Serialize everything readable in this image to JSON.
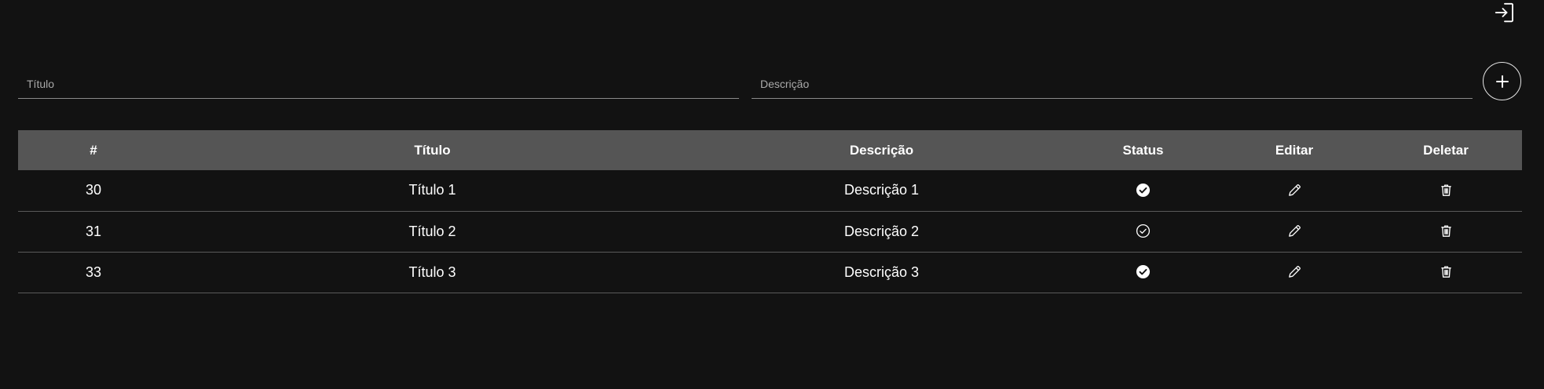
{
  "header": {
    "logout_icon": "sign-in-icon"
  },
  "form": {
    "title_placeholder": "Título",
    "title_value": "",
    "description_placeholder": "Descrição",
    "description_value": "",
    "add_icon": "plus-icon"
  },
  "table": {
    "columns": [
      "#",
      "Título",
      "Descrição",
      "Status",
      "Editar",
      "Deletar"
    ],
    "rows": [
      {
        "id": "30",
        "title": "Título 1",
        "description": "Descrição 1",
        "status": "done"
      },
      {
        "id": "31",
        "title": "Título 2",
        "description": "Descrição 2",
        "status": "pending"
      },
      {
        "id": "33",
        "title": "Título 3",
        "description": "Descrição 3",
        "status": "done"
      }
    ],
    "icons": {
      "status_done": "check-circle-filled-icon",
      "status_pending": "check-circle-outline-icon",
      "edit": "pencil-icon",
      "delete": "trash-icon"
    }
  },
  "colors": {
    "background": "#121212",
    "header_row": "#555555",
    "divider": "#5a5a5a",
    "text": "#ffffff"
  }
}
